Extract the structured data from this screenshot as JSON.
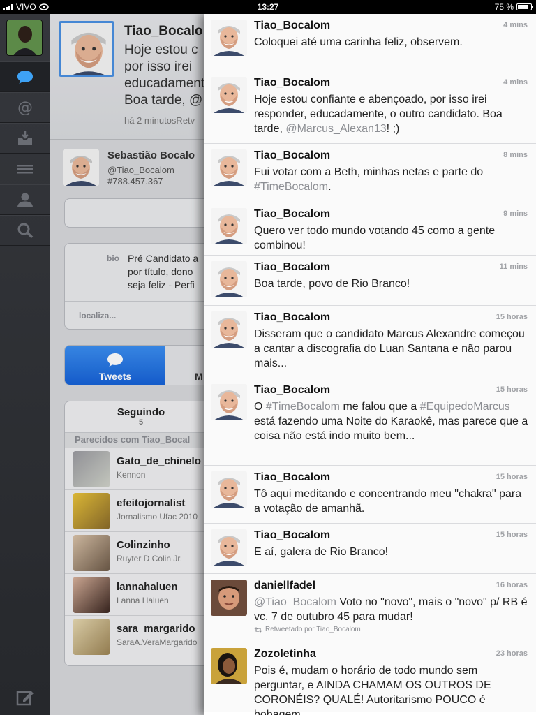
{
  "status": {
    "carrier": "VIVO",
    "time": "13:27",
    "battery": "75 %",
    "battery_level": 0.75
  },
  "sidebar": {
    "items": [
      "timeline",
      "mentions",
      "messages",
      "lists",
      "profile",
      "search"
    ],
    "compose": "compose"
  },
  "profile": {
    "name": "Tiao_Bocalo",
    "tweet_lines": [
      "Hoje estou c",
      "por isso irei",
      "educadament",
      "Boa tarde, @"
    ],
    "time_ago": "há 2 minutosRetv",
    "full_name": "Sebastião Bocalo",
    "handle": "@Tiao_Bocalom",
    "id": "#788.457.367",
    "bio_label": "bio",
    "bio_lines": [
      "Pré Candidato a",
      "por título, dono",
      "seja feliz - Perfi"
    ],
    "location_label": "localiza...",
    "tab_active": "Tweets",
    "tab_other": "M",
    "following_label": "Seguindo",
    "following_count": "5",
    "similar_label": "Parecidos com  Tiao_Bocal",
    "similar": [
      {
        "user": "Gato_de_chinelo",
        "name": "Kennon",
        "color1": "#9a9aa0",
        "color2": "#cfd2c9"
      },
      {
        "user": "efeitojornalist",
        "name": "Jornalismo Ufac 2010",
        "color1": "#e8c23a",
        "color2": "#8a6b2a"
      },
      {
        "user": "Colinzinho",
        "name": "Ruyter D Colin Jr.",
        "color1": "#d9c2a8",
        "color2": "#6d5a48"
      },
      {
        "user": "lannahaluen",
        "name": "Lanna Haluen",
        "color1": "#d8b19b",
        "color2": "#3a2620"
      },
      {
        "user": "sara_margarido",
        "name": "SaraA.VeraMargarido",
        "color1": "#e6d8b0",
        "color2": "#9c8455"
      }
    ]
  },
  "tweets": [
    {
      "user": "Tiao_Bocalom",
      "age": "4 mins",
      "text": "Coloquei até uma carinha feliz, observem.",
      "mentions": [],
      "avatar": "bocalom",
      "retweet": ""
    },
    {
      "user": "Tiao_Bocalom",
      "age": "4 mins",
      "text": "Hoje estou confiante e abençoado, por isso irei responder, educadamente, o outro candidato. Boa tarde, ",
      "mention_tail": "@Marcus_Alexan13",
      "tail": "! ;)",
      "avatar": "bocalom",
      "retweet": ""
    },
    {
      "user": "Tiao_Bocalom",
      "age": "8 mins",
      "text": "Fui votar com a Beth, minhas netas e parte do ",
      "mention_tail": "#TimeBocalom",
      "tail": ".",
      "avatar": "bocalom",
      "retweet": ""
    },
    {
      "user": "Tiao_Bocalom",
      "age": "9 mins",
      "text": "Quero ver todo mundo votando 45 como a gente combinou!",
      "avatar": "bocalom",
      "retweet": ""
    },
    {
      "user": "Tiao_Bocalom",
      "age": "11 mins",
      "text": "Boa tarde, povo de Rio Branco!",
      "avatar": "bocalom",
      "retweet": ""
    },
    {
      "user": "Tiao_Bocalom",
      "age": "15 horas",
      "text": "Disseram que o candidato Marcus Alexandre começou a cantar a discografia do Luan Santana e não parou mais...",
      "avatar": "bocalom",
      "retweet": ""
    },
    {
      "user": "Tiao_Bocalom",
      "age": "15 horas",
      "pre": "O ",
      "m1": "#TimeBocalom",
      "mid": " me falou que a ",
      "m2": "#EquipedoMarcus",
      "text": " está fazendo uma Noite do Karaokê, mas parece que a coisa não está indo muito bem...",
      "avatar": "bocalom",
      "retweet": ""
    },
    {
      "user": "Tiao_Bocalom",
      "age": "15 horas",
      "text": "Tô aqui meditando e concentrando meu \"chakra\" para a votação de amanhã.",
      "avatar": "bocalom",
      "retweet": ""
    },
    {
      "user": "Tiao_Bocalom",
      "age": "15 horas",
      "text": "E aí, galera de Rio Branco!",
      "avatar": "bocalom",
      "retweet": ""
    },
    {
      "user": "daniellfadel",
      "age": "16 horas",
      "pre": "",
      "m1": "@Tiao_Bocalom",
      "text": " Voto no \"novo\", mais o \"novo\" p/ RB  é vc, 7 de outubro 45 para mudar!",
      "avatar": "daniel",
      "retweet": "Retweetado por Tiao_Bocalom"
    },
    {
      "user": "Zozoletinha",
      "age": "23 horas",
      "text": "Pois é, mudam o horário de todo mundo sem perguntar, e AINDA CHAMAM OS OUTROS DE CORONÉIS? QUALÉ! Autoritarismo POUCO é bobagem...",
      "avatar": "zozo",
      "retweet": ""
    }
  ]
}
